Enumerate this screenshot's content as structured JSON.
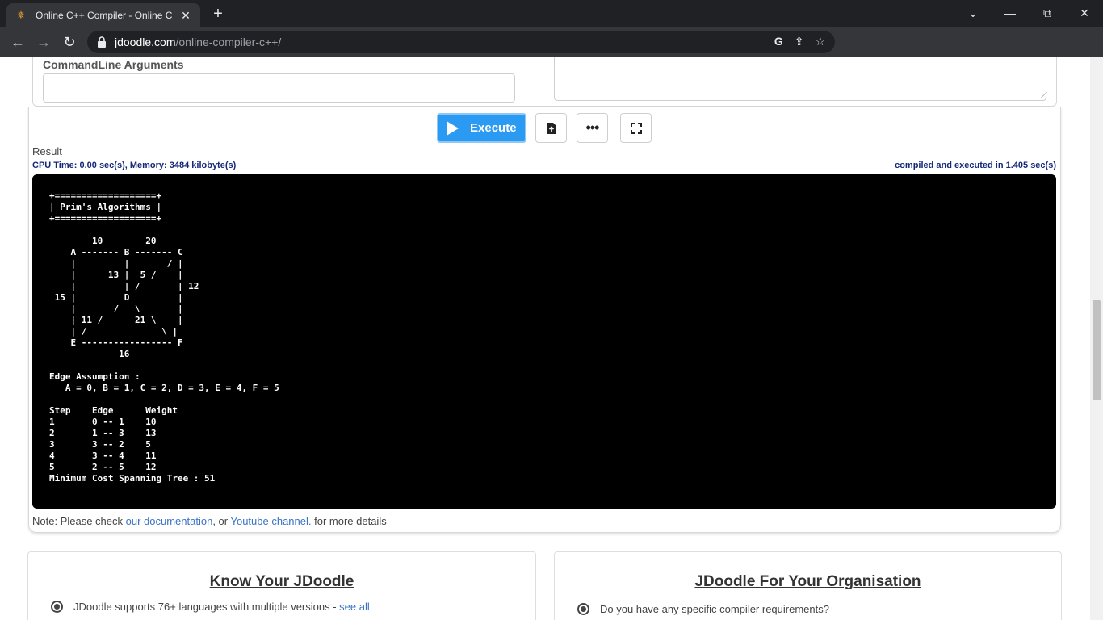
{
  "browser": {
    "tab_title": "Online C++ Compiler - Online C",
    "url_host": "jdoodle.com",
    "url_path": "/online-compiler-c++/"
  },
  "editor": {
    "cmd_label": "CommandLine Arguments"
  },
  "actions": {
    "execute_label": "Execute"
  },
  "result": {
    "title": "Result",
    "cpu": "CPU Time: 0.00 sec(s), Memory: 3484 kilobyte(s)",
    "compiled": "compiled and executed in 1.405 sec(s)",
    "output": "+===================+\n| Prim's Algorithms |\n+===================+\n\n        10        20\n    A ------- B ------- C\n    |         |       / |\n    |      13 |  5 /    |\n    |         | /       | 12\n 15 |         D         |\n    |       /   \\       |\n    | 11 /      21 \\    |\n    | /              \\ |\n    E ----------------- F\n             16\n\nEdge Assumption :\n   A = 0, B = 1, C = 2, D = 3, E = 4, F = 5\n\nStep    Edge      Weight\n1       0 -- 1    10\n2       1 -- 3    13\n3       3 -- 2    5\n4       3 -- 4    11\n5       2 -- 5    12\nMinimum Cost Spanning Tree : 51"
  },
  "note": {
    "prefix": "Note: Please check ",
    "doc_link": "our documentation",
    "middle": ", or ",
    "yt_link": "Youtube channel.",
    "suffix": " for more details"
  },
  "know": {
    "title": "Know Your JDoodle",
    "item": "JDoodle supports 76+ languages with multiple versions - ",
    "item_link": "see all."
  },
  "org": {
    "title": "JDoodle For Your Organisation",
    "item": "Do you have any specific compiler requirements?"
  },
  "colors": {
    "execute": "#2b9af3",
    "console_bg": "#000000",
    "info_text": "#14287a",
    "link": "#3a73c4"
  }
}
